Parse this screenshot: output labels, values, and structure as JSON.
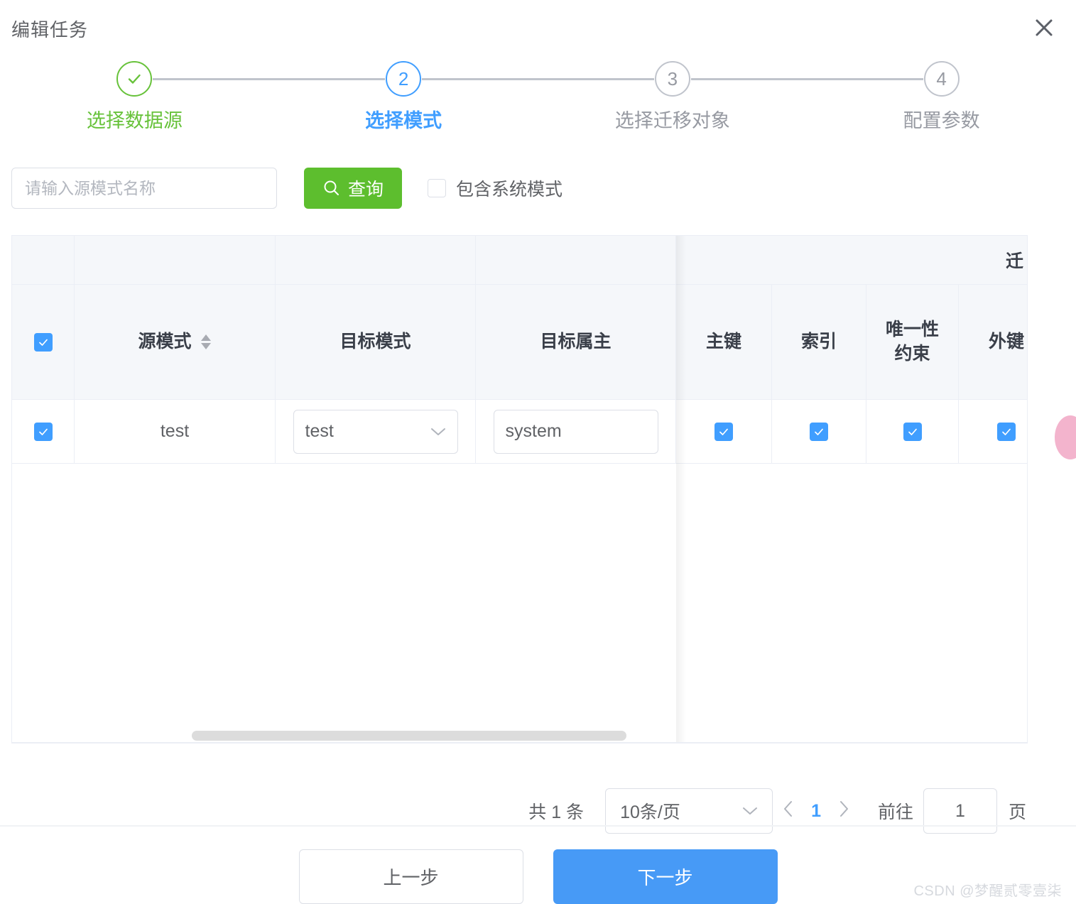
{
  "dialog": {
    "title": "编辑任务",
    "close_icon": "close-icon"
  },
  "stepper": {
    "steps": [
      {
        "num": "",
        "label": "选择数据源",
        "state": "done",
        "icon": "check-icon"
      },
      {
        "num": "2",
        "label": "选择模式",
        "state": "active"
      },
      {
        "num": "3",
        "label": "选择迁移对象",
        "state": "pending"
      },
      {
        "num": "4",
        "label": "配置参数",
        "state": "pending"
      }
    ]
  },
  "filter": {
    "search_value": "",
    "search_placeholder": "请输入源模式名称",
    "query_label": "查询",
    "search_icon": "search-icon",
    "system_schema_label": "包含系统模式",
    "system_schema_checked": false
  },
  "table": {
    "group_header": "迁",
    "columns": [
      {
        "key": "select_all",
        "label": "",
        "type": "checkbox",
        "checked": true
      },
      {
        "key": "source_schema",
        "label": "源模式",
        "sortable": true
      },
      {
        "key": "target_schema",
        "label": "目标模式"
      },
      {
        "key": "target_owner",
        "label": "目标属主"
      },
      {
        "key": "primary_key",
        "label": "主键"
      },
      {
        "key": "index",
        "label": "索引"
      },
      {
        "key": "unique_constraint",
        "label": "唯一性\n约束"
      },
      {
        "key": "foreign_key",
        "label": "外键"
      },
      {
        "key": "partial",
        "label": ""
      }
    ],
    "column_labels": {
      "source_schema": "源模式",
      "target_schema": "目标模式",
      "target_owner": "目标属主",
      "primary_key": "主键",
      "index": "索引",
      "unique_constraint_line1": "唯一性",
      "unique_constraint_line2": "约束",
      "foreign_key": "外键"
    },
    "rows": [
      {
        "selected": true,
        "source_schema": "test",
        "target_schema": "test",
        "target_owner": "system",
        "primary_key": true,
        "index": true,
        "unique_constraint": true,
        "foreign_key": true
      }
    ]
  },
  "pagination": {
    "total_text": "共 1 条",
    "page_size": "10条/页",
    "prev_icon": "chevron-left-icon",
    "next_icon": "chevron-right-icon",
    "current_page": "1",
    "jump_label": "前往",
    "jump_value": "1",
    "page_unit": "页"
  },
  "footer": {
    "prev_label": "上一步",
    "next_label": "下一步"
  },
  "watermark": "CSDN @梦醒贰零壹柒",
  "colors": {
    "green": "#5dbe2e",
    "blue": "#409eff",
    "next_button": "#479af6",
    "grey": "#c0c4cc",
    "header_bg": "#f5f7fa"
  }
}
